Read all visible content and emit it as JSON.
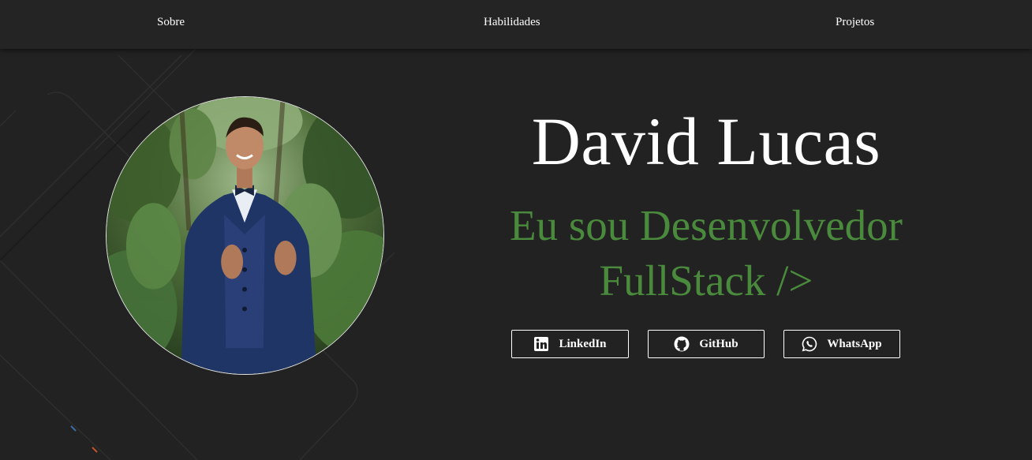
{
  "nav": {
    "items": [
      {
        "label": "Sobre"
      },
      {
        "label": "Habilidades"
      },
      {
        "label": "Projetos"
      }
    ]
  },
  "hero": {
    "name": "David Lucas",
    "role_line1": "Eu sou Desenvolvedor",
    "role_line2": "FullStack />",
    "photo_icon": "profile-photo"
  },
  "socials": [
    {
      "label": "LinkedIn",
      "icon": "linkedin-icon"
    },
    {
      "label": "GitHub",
      "icon": "github-icon"
    },
    {
      "label": "WhatsApp",
      "icon": "whatsapp-icon"
    }
  ],
  "colors": {
    "background": "#222222",
    "navbar": "#242424",
    "text": "#ffffff",
    "accent_green": "#4a8a3c"
  }
}
